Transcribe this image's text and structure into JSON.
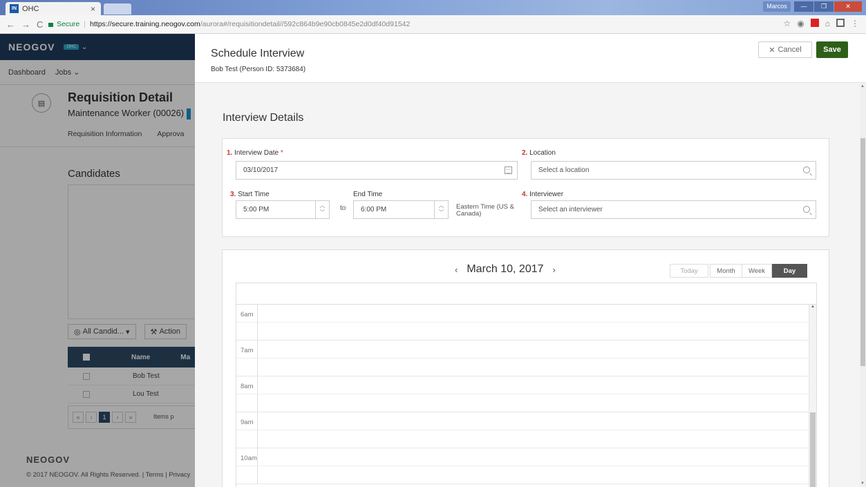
{
  "browser": {
    "tab_title": "OHC",
    "tab_favicon": "IN",
    "user_label": "Marcos",
    "secure_label": "Secure",
    "url_host": "https://secure.training.neogov.com",
    "url_path": "/aurora#/requisitiondetail//592c864b9e90cb0845e2d0df40d91542"
  },
  "app": {
    "logo": "NEOGOV",
    "product_badge": "OHC",
    "nav": [
      "Dashboard",
      "Jobs"
    ],
    "requisition_title": "Requisition Detail",
    "requisition_subtitle": "Maintenance Worker (00026)",
    "requisition_tabs": [
      "Requisition Information",
      "Approva"
    ],
    "candidates_title": "Candidates",
    "filter_label": "All Candid...",
    "actions_label": "Action",
    "grid_headers": [
      "Name",
      "Ma"
    ],
    "rows": [
      "Bob Test",
      "Lou Test"
    ],
    "current_page": "1",
    "items_per_page_label": "Items p",
    "footer_logo": "NEOGOV",
    "footer_copy": "© 2017 NEOGOV. All Rights Reserved. | Terms | Privacy"
  },
  "panel": {
    "title": "Schedule Interview",
    "subtitle": "Bob Test (Person ID: 5373684)",
    "cancel_label": "Cancel",
    "save_label": "Save",
    "section_title": "Interview Details",
    "fields": {
      "date_num": "1.",
      "date_label": "Interview Date",
      "date_required": "*",
      "date_value": "03/10/2017",
      "location_num": "2.",
      "location_label": "Location",
      "location_placeholder": "Select a location",
      "start_num": "3.",
      "start_label": "Start Time",
      "start_value": "5:00 PM",
      "to_label": "to",
      "end_label": "End Time",
      "end_value": "6:00 PM",
      "timezone": "Eastern Time (US & Canada)",
      "interviewer_num": "4.",
      "interviewer_label": "Interviewer",
      "interviewer_placeholder": "Select an interviewer"
    },
    "calendar": {
      "date_label": "March 10, 2017",
      "views": [
        "Today",
        "Month",
        "Week",
        "Day"
      ],
      "active_view": "Day",
      "hours": [
        "6am",
        "7am",
        "8am",
        "9am",
        "10am"
      ]
    }
  }
}
